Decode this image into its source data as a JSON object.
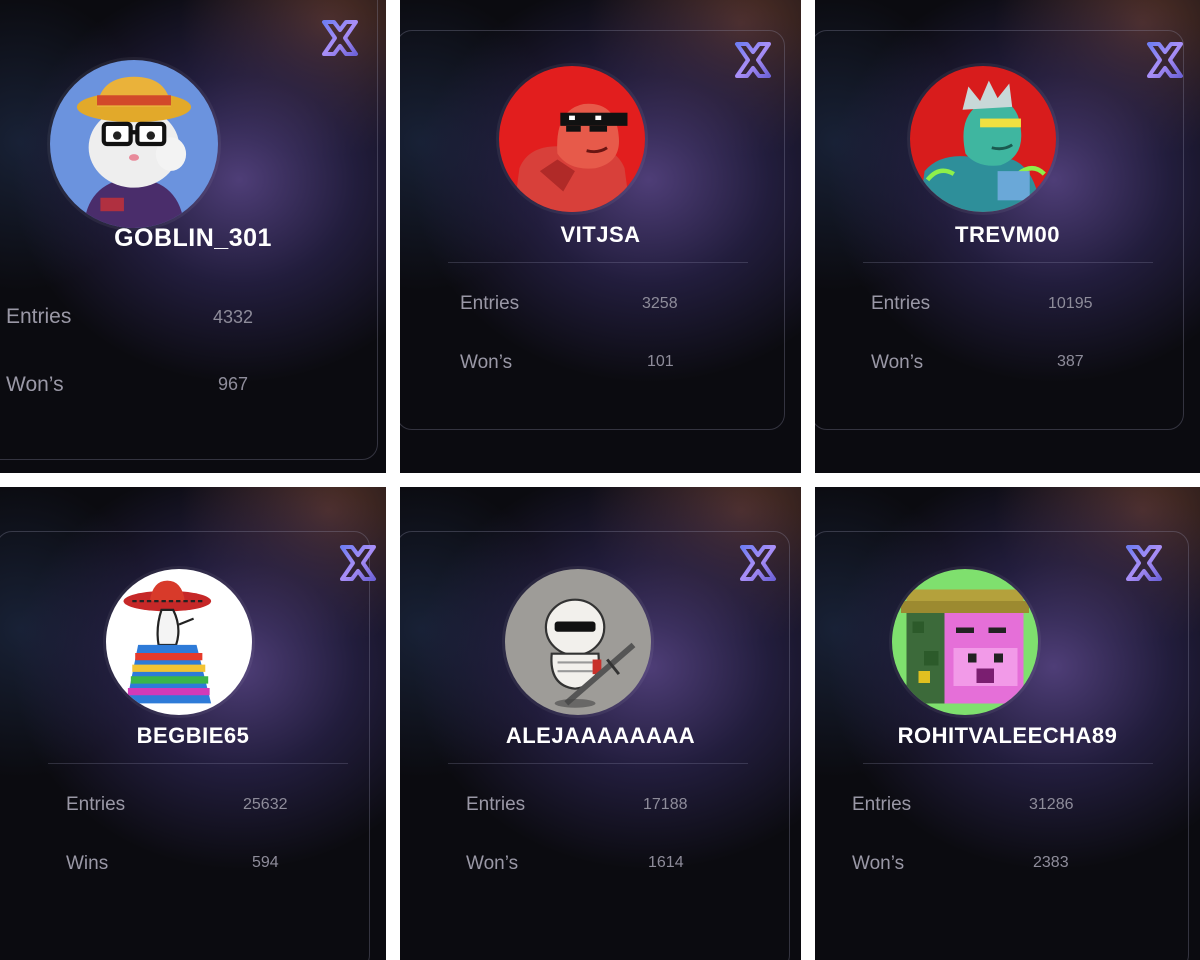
{
  "cards": [
    {
      "username": "GOBLIN_301",
      "stat1_label": "Entries",
      "stat1_value": "4332",
      "stat2_label": "Won’s",
      "stat2_value": "967",
      "avatar_icon": "hamster-straw-hat-glasses-avatar-icon",
      "avatar_bg": "#6b93de"
    },
    {
      "username": "VITJSA",
      "stat1_label": "Entries",
      "stat1_value": "3258",
      "stat2_label": "Won’s",
      "stat2_value": "101",
      "avatar_icon": "red-comic-hero-pixel-sunglasses-avatar-icon",
      "avatar_bg": "#e21e1e"
    },
    {
      "username": "TREVM00",
      "stat1_label": "Entries",
      "stat1_value": "10195",
      "stat2_label": "Won’s",
      "stat2_value": "387",
      "avatar_icon": "green-cyborg-hero-avatar-icon",
      "avatar_bg": "#d81c1c"
    },
    {
      "username": "BEGBIE65",
      "stat1_label": "Entries",
      "stat1_value": "25632",
      "stat2_label": "Wins",
      "stat2_value": "594",
      "avatar_icon": "sombrero-poncho-character-avatar-icon",
      "avatar_bg": "#ffffff"
    },
    {
      "username": "ALEJAAAAAAAA",
      "stat1_label": "Entries",
      "stat1_value": "17188",
      "stat2_label": "Won’s",
      "stat2_value": "1614",
      "avatar_icon": "helmet-character-with-sword-avatar-icon",
      "avatar_bg": "#9e9c98"
    },
    {
      "username": "ROHITVALEECHA89",
      "stat1_label": "Entries",
      "stat1_value": "31286",
      "stat2_label": "Won’s",
      "stat2_value": "2383",
      "avatar_icon": "pixel-pink-ape-avatar-icon",
      "avatar_bg": "#7fe06e"
    }
  ],
  "colors": {
    "logo_gradient_start": "#7b6cf0",
    "logo_gradient_end": "#c2a8ff",
    "tile_background": "#0b0b10"
  }
}
